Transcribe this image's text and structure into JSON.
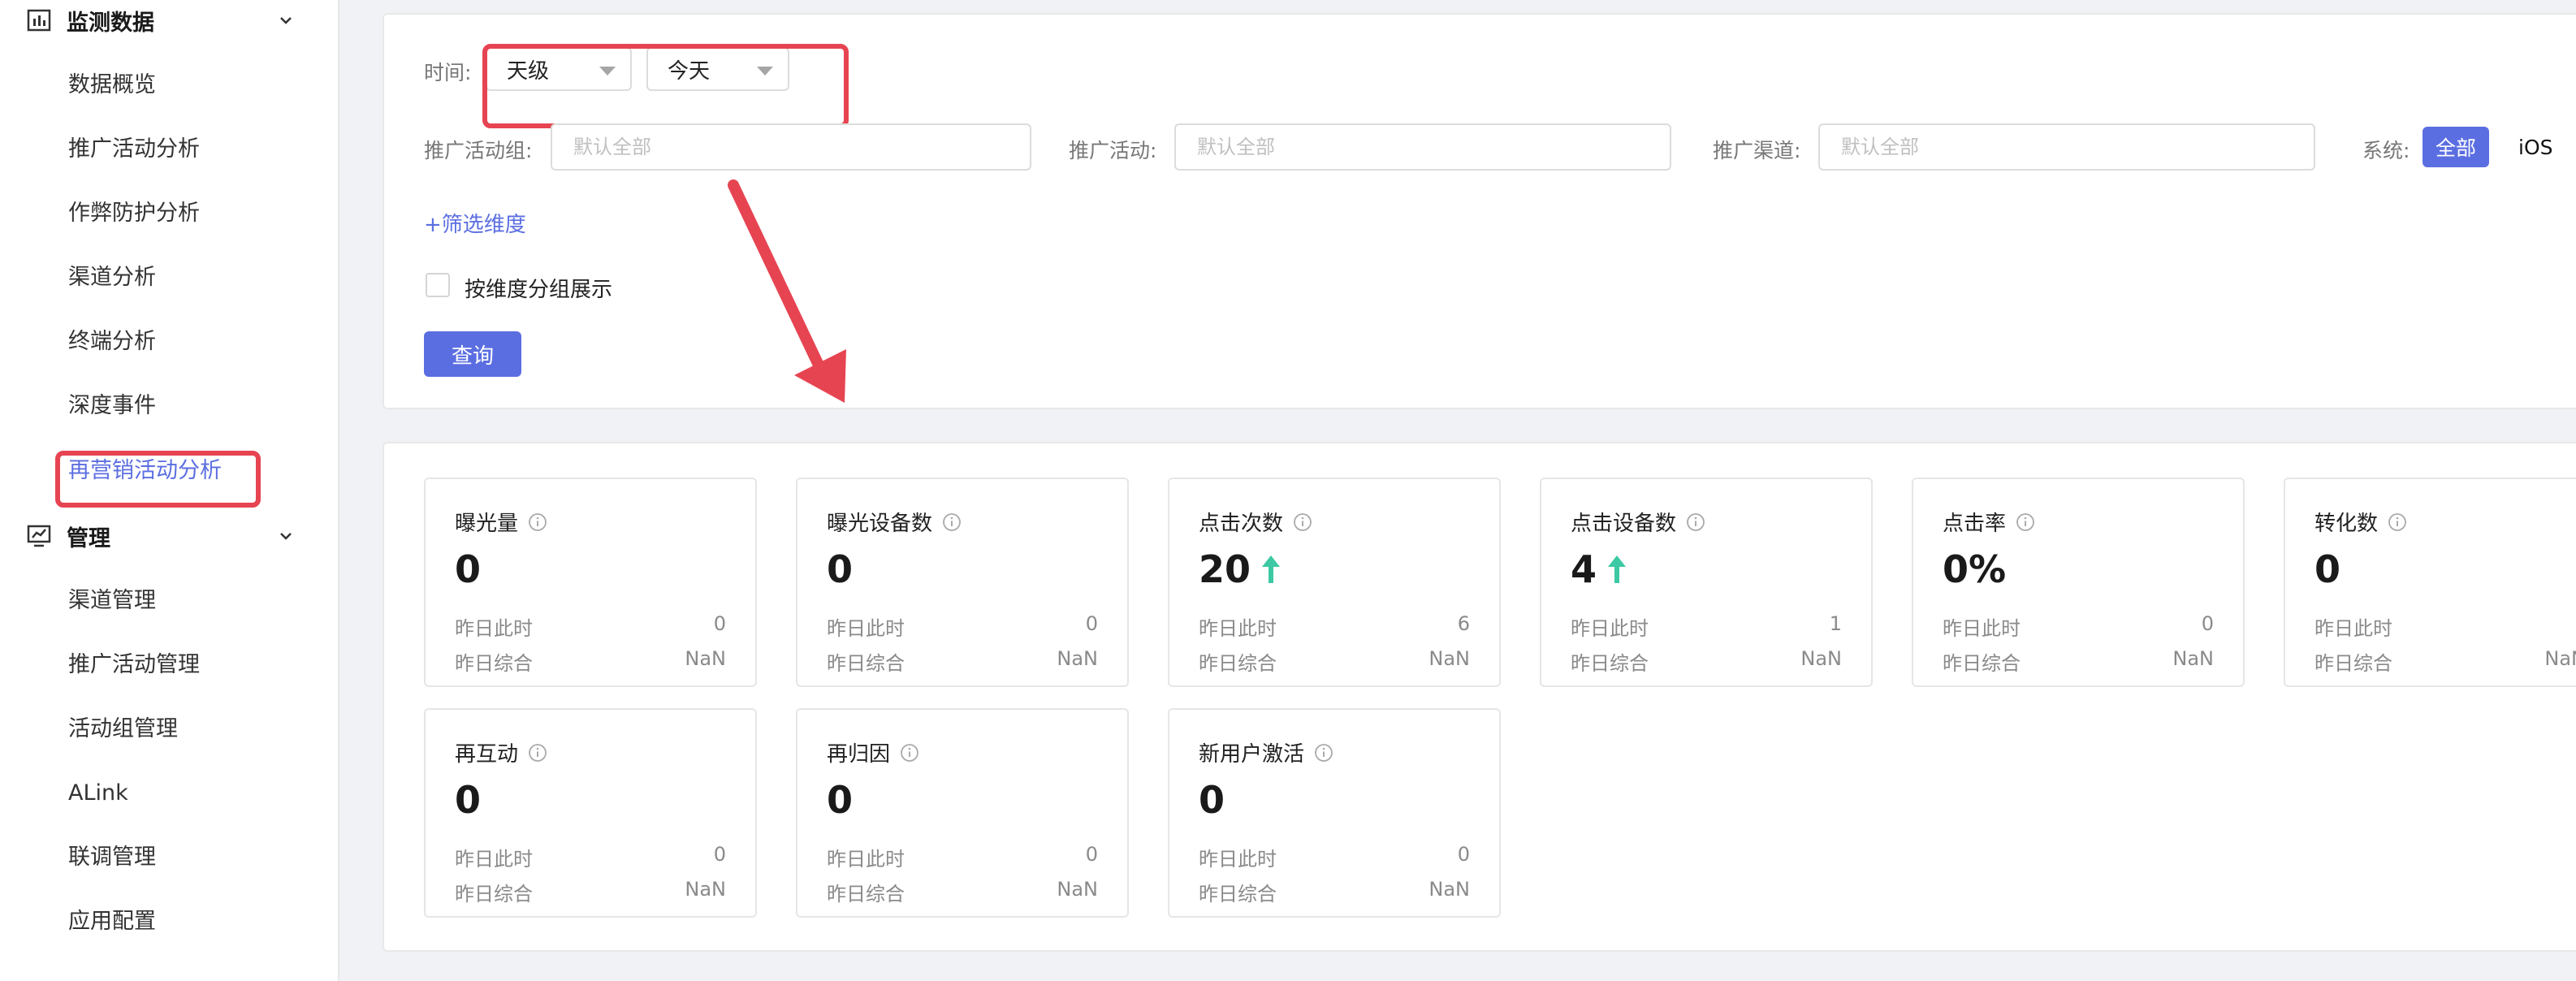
{
  "sidebar": {
    "groups": [
      {
        "label": "监测数据",
        "items": [
          "数据概览",
          "推广活动分析",
          "作弊防护分析",
          "渠道分析",
          "终端分析",
          "深度事件",
          "再营销活动分析"
        ]
      },
      {
        "label": "管理",
        "items": [
          "渠道管理",
          "推广活动管理",
          "活动组管理",
          "ALink",
          "联调管理",
          "应用配置"
        ]
      }
    ],
    "active_item": "再营销活动分析"
  },
  "filters": {
    "time_label": "时间:",
    "granularity": "天级",
    "date_range": "今天",
    "campaign_group_label": "推广活动组:",
    "campaign_group_placeholder": "默认全部",
    "campaign_label": "推广活动:",
    "campaign_placeholder": "默认全部",
    "channel_label": "推广渠道:",
    "channel_placeholder": "默认全部",
    "system_label": "系统:",
    "system_options": [
      "全部",
      "iOS"
    ],
    "system_selected": "全部",
    "add_dimension": "+筛选维度",
    "group_by_dimension": "按维度分组展示",
    "query_button": "查询"
  },
  "stats": {
    "yesterday_same_time_label": "昨日此时",
    "yesterday_total_label": "昨日综合",
    "cards": [
      {
        "title": "曝光量",
        "value": "0",
        "trend": "none",
        "yesterday_now": "0",
        "yesterday_total": "NaN"
      },
      {
        "title": "曝光设备数",
        "value": "0",
        "trend": "none",
        "yesterday_now": "0",
        "yesterday_total": "NaN"
      },
      {
        "title": "点击次数",
        "value": "20",
        "trend": "up",
        "yesterday_now": "6",
        "yesterday_total": "NaN"
      },
      {
        "title": "点击设备数",
        "value": "4",
        "trend": "up",
        "yesterday_now": "1",
        "yesterday_total": "NaN"
      },
      {
        "title": "点击率",
        "value": "0%",
        "trend": "none",
        "yesterday_now": "0",
        "yesterday_total": "NaN"
      },
      {
        "title": "转化数",
        "value": "0",
        "trend": "none",
        "yesterday_now": "",
        "yesterday_total": "NaN"
      },
      {
        "title": "再互动",
        "value": "0",
        "trend": "none",
        "yesterday_now": "0",
        "yesterday_total": "NaN"
      },
      {
        "title": "再归因",
        "value": "0",
        "trend": "none",
        "yesterday_now": "0",
        "yesterday_total": "NaN"
      },
      {
        "title": "新用户激活",
        "value": "0",
        "trend": "none",
        "yesterday_now": "0",
        "yesterday_total": "NaN"
      }
    ]
  },
  "colors": {
    "accent": "#5b6ee1",
    "highlight": "#e74452",
    "trend_up": "#3cc9a3"
  }
}
